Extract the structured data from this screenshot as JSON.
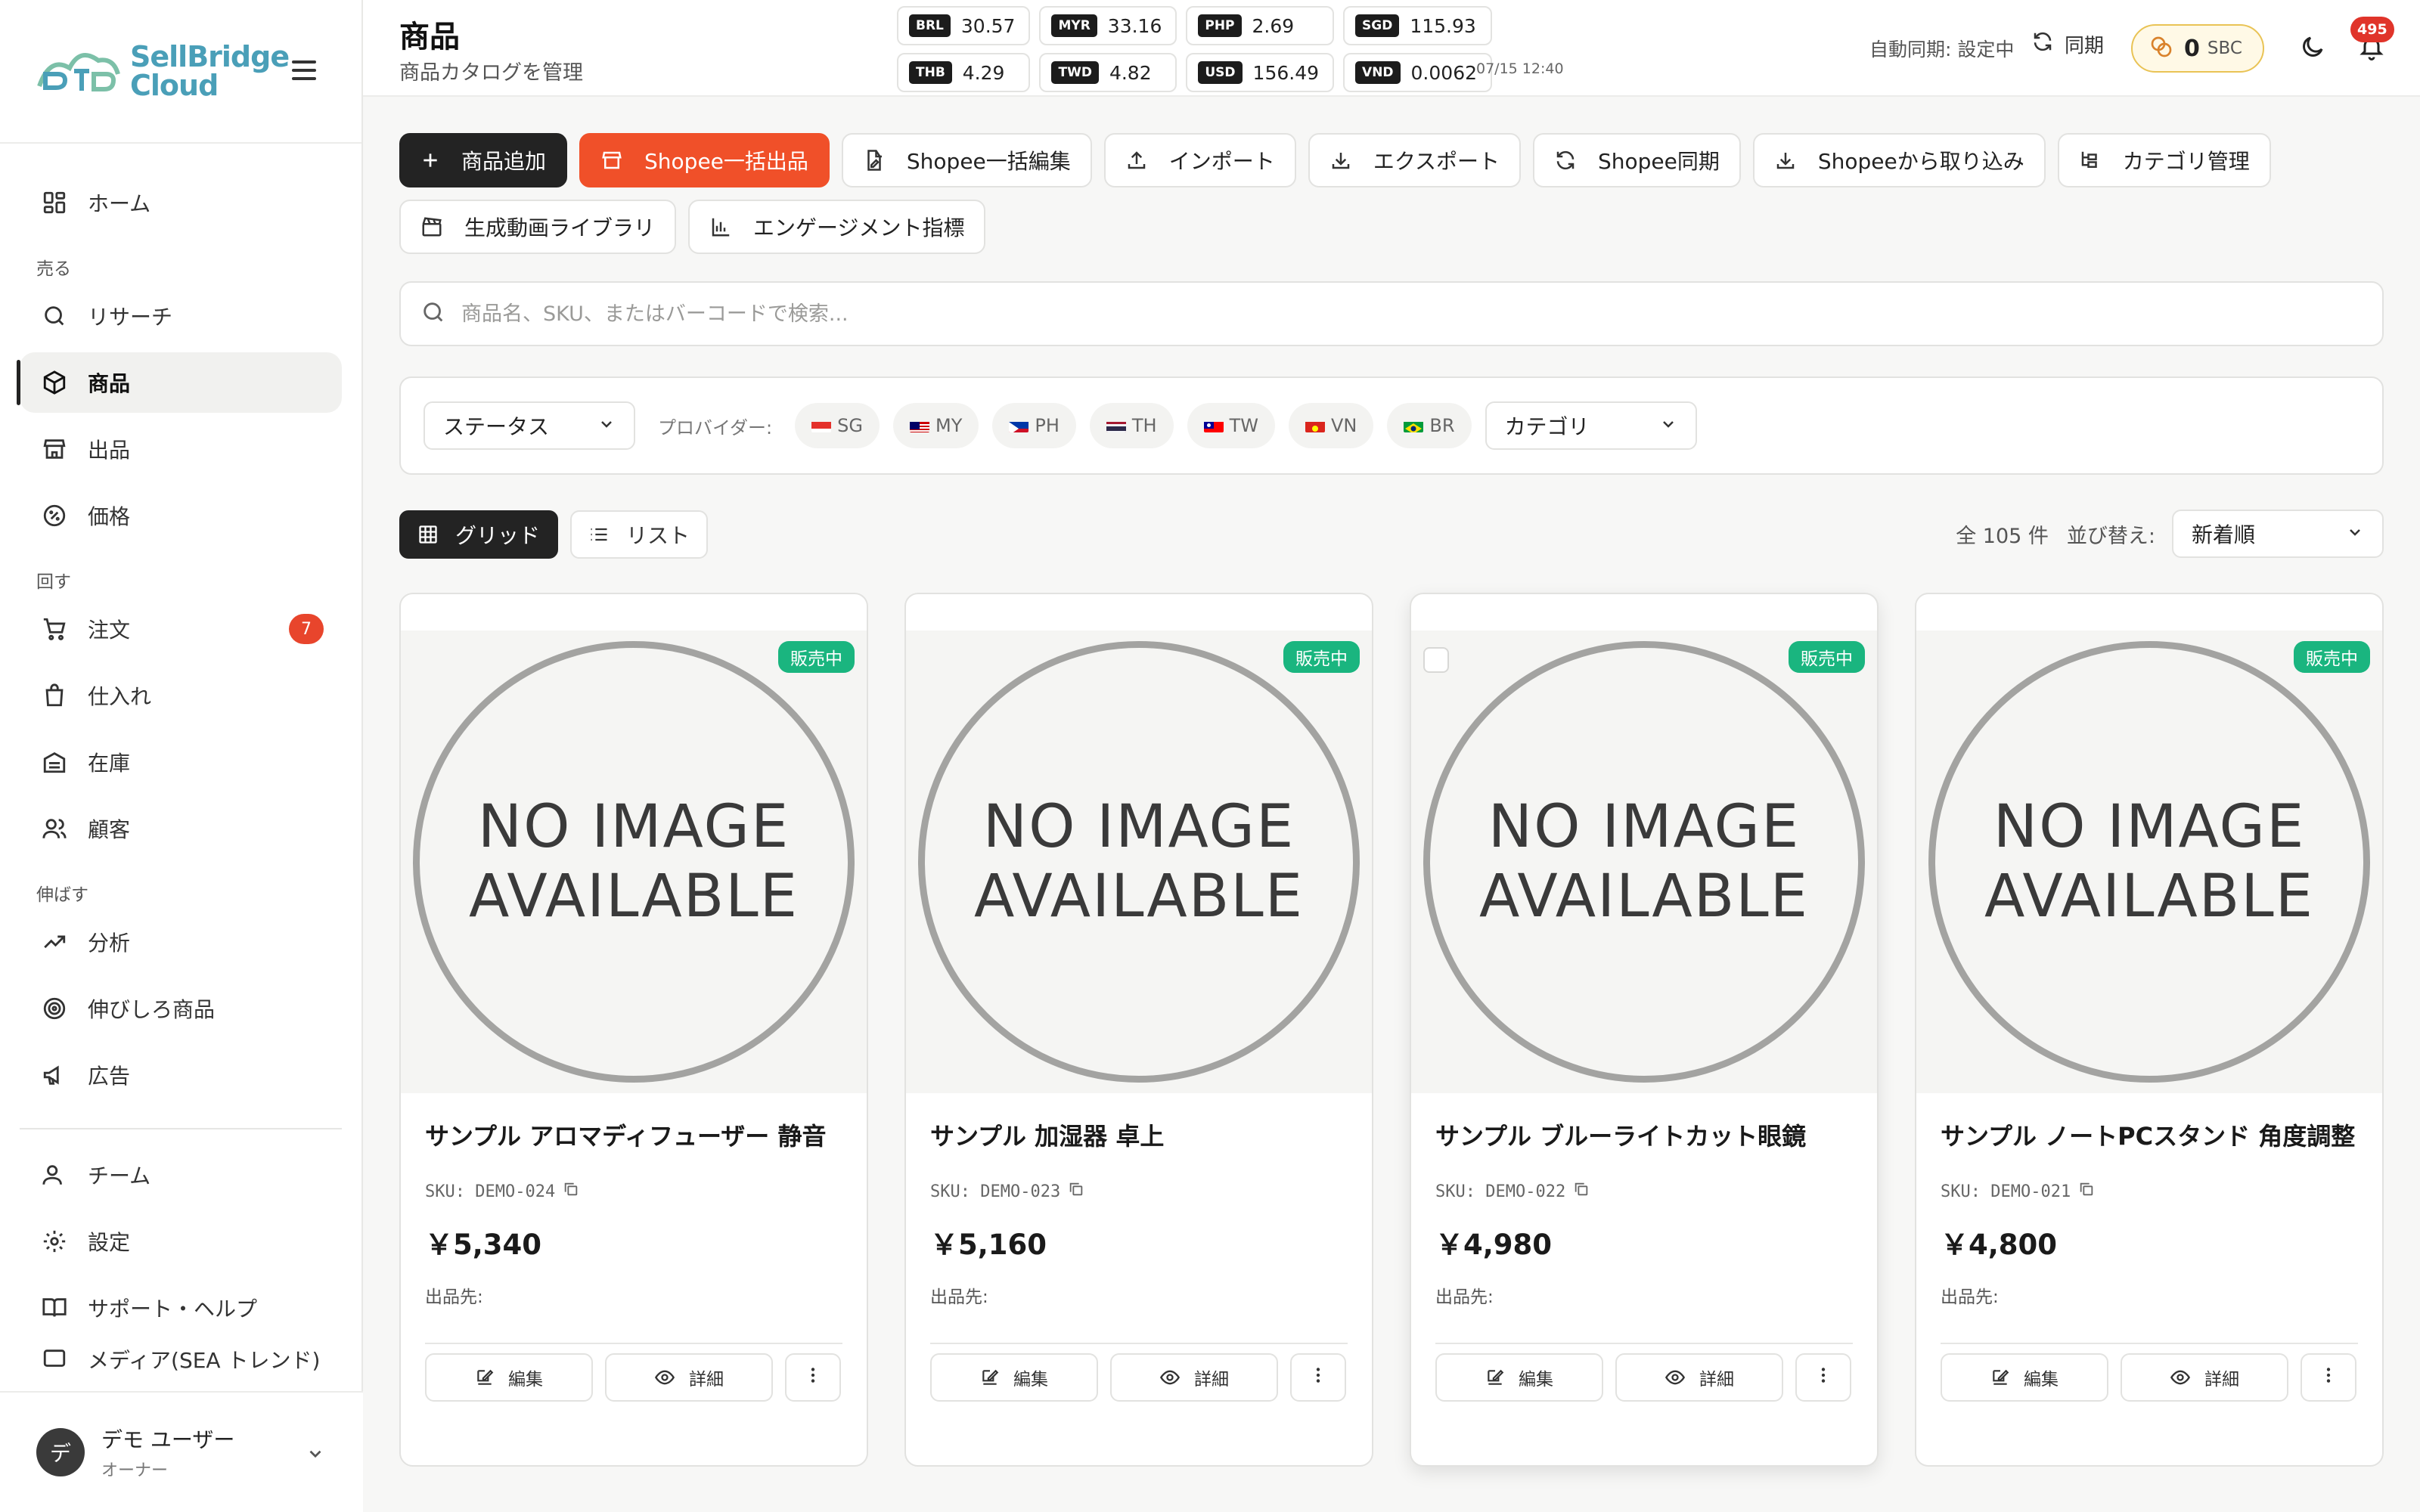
{
  "brand": {
    "line1": "SellBridge",
    "line2": "Cloud"
  },
  "sidebar": {
    "home": "ホーム",
    "sections": {
      "sell": "売る",
      "run": "回す",
      "grow": "伸ばす"
    },
    "items": {
      "research": "リサーチ",
      "products": "商品",
      "listings": "出品",
      "pricing": "価格",
      "orders": "注文",
      "orders_badge": "7",
      "purchasing": "仕入れ",
      "inventory": "在庫",
      "customers": "顧客",
      "analytics": "分析",
      "growth_products": "伸びしろ商品",
      "ads": "広告",
      "team": "チーム",
      "settings": "設定",
      "support": "サポート・ヘルプ",
      "media": "メディア(SEA トレンド)"
    },
    "user": {
      "initial": "デ",
      "name": "デモ ユーザー",
      "role": "オーナー"
    }
  },
  "header": {
    "title": "商品",
    "subtitle": "商品カタログを管理",
    "rates": [
      {
        "code": "BRL",
        "value": "30.57"
      },
      {
        "code": "MYR",
        "value": "33.16"
      },
      {
        "code": "PHP",
        "value": "2.69"
      },
      {
        "code": "SGD",
        "value": "115.93"
      },
      {
        "code": "THB",
        "value": "4.29"
      },
      {
        "code": "TWD",
        "value": "4.82"
      },
      {
        "code": "USD",
        "value": "156.49"
      },
      {
        "code": "VND",
        "value": "0.0062"
      }
    ],
    "rate_time": "07/15 12:40",
    "auto_sync": "自動同期: 設定中",
    "sync": "同期",
    "sbc_value": "0",
    "sbc_unit": "SBC",
    "notifications": "495"
  },
  "actions": {
    "add": "商品追加",
    "bulk_list": "Shopee一括出品",
    "bulk_edit": "Shopee一括編集",
    "import": "インポート",
    "export": "エクスポート",
    "shopee_sync": "Shopee同期",
    "shopee_import": "Shopeeから取り込み",
    "categories": "カテゴリ管理",
    "video_library": "生成動画ライブラリ",
    "engagement": "エンゲージメント指標"
  },
  "search": {
    "placeholder": "商品名、SKU、またはバーコードで検索..."
  },
  "filters": {
    "status": "ステータス",
    "provider_label": "プロバイダー:",
    "providers": [
      "SG",
      "MY",
      "PH",
      "TH",
      "TW",
      "VN",
      "BR"
    ],
    "category": "カテゴリ"
  },
  "view": {
    "grid": "グリッド",
    "list": "リスト",
    "total": "全 105 件",
    "sort_label": "並び替え:",
    "sort_value": "新着順"
  },
  "card_labels": {
    "no_image_1": "NO IMAGE",
    "no_image_2": "AVAILABLE",
    "status": "販売中",
    "channels": "出品先:",
    "edit": "編集",
    "detail": "詳細"
  },
  "products": [
    {
      "name": "サンプル アロマディフューザー 静音",
      "sku": "SKU: DEMO-024",
      "price": "￥5,340"
    },
    {
      "name": "サンプル 加湿器 卓上",
      "sku": "SKU: DEMO-023",
      "price": "￥5,160"
    },
    {
      "name": "サンプル ブルーライトカット眼鏡",
      "sku": "SKU: DEMO-022",
      "price": "￥4,980"
    },
    {
      "name": "サンプル ノートPCスタンド 角度調整",
      "sku": "SKU: DEMO-021",
      "price": "￥4,800"
    }
  ],
  "colors": {
    "accent_orange": "#f05029",
    "status_green": "#1ab57f",
    "badge_red": "#e8452c",
    "brand_teal": "#4a9fb8"
  }
}
